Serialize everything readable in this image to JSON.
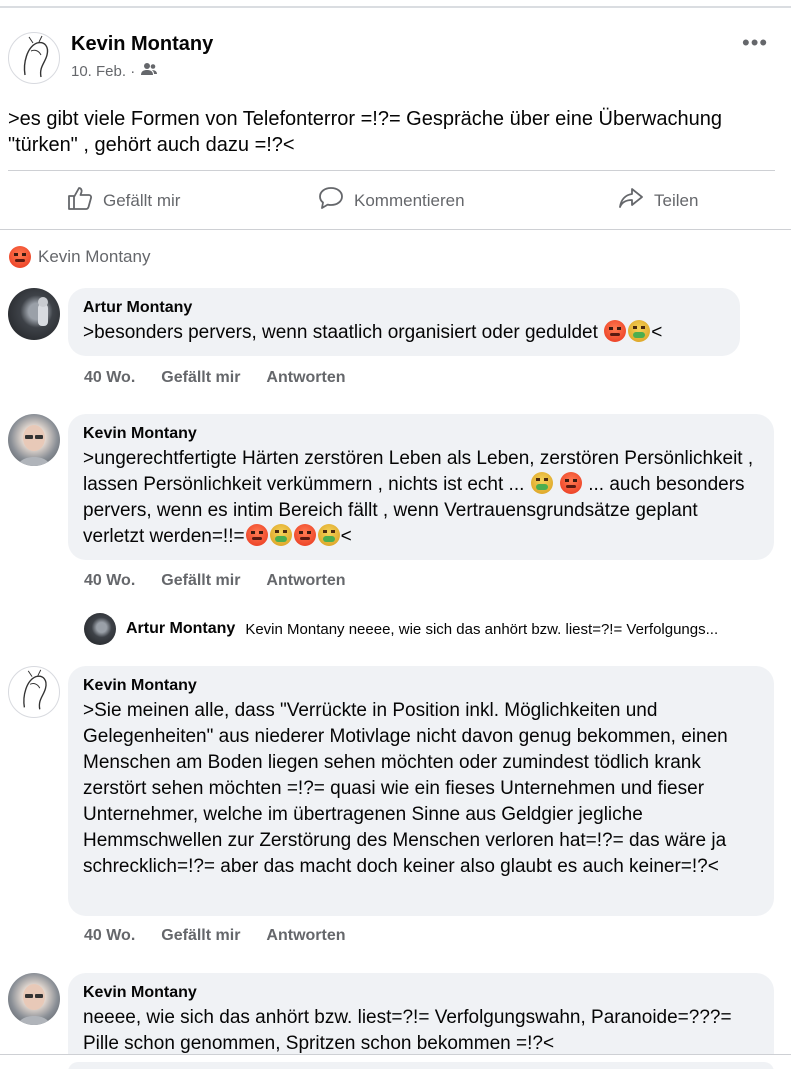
{
  "post": {
    "author": "Kevin Montany",
    "date": "10. Feb. ·",
    "text": ">es gibt viele Formen von Telefonterror =!?= Gespräche über eine Überwachung \"türken\" , gehört auch dazu =!?<"
  },
  "actions": {
    "like": "Gefällt mir",
    "comment": "Kommentieren",
    "share": "Teilen"
  },
  "reaction": {
    "icon": "angry-emoji",
    "name": "Kevin Montany"
  },
  "comments": [
    {
      "author": "Artur Montany",
      "text": ">besonders pervers, wenn staatlich organisiert oder geduldet",
      "suffix": "<",
      "time": "40 Wo.",
      "like": "Gefällt mir",
      "reply": "Antworten"
    },
    {
      "author": "Kevin Montany",
      "text1": ">ungerechtfertigte Härten zerstören Leben als Leben, zerstören Persönlichkeit , lassen Persönlichkeit verkümmern , nichts ist echt ...",
      "text2": "... auch  besonders pervers, wenn es intim Bereich fällt , wenn Vertrauensgrundsätze geplant verletzt werden=!!=",
      "suffix": "<",
      "time": "40 Wo.",
      "like": "Gefällt mir",
      "reply": "Antworten"
    },
    {
      "author": "Kevin Montany",
      "text": ">Sie meinen alle, dass \"Verrückte in Position inkl. Möglichkeiten und Gelegenheiten\"  aus niederer Motivlage nicht davon genug bekommen, einen Menschen am Boden  liegen sehen möchten oder zumindest tödlich krank zerstört sehen möchten =!?= quasi wie ein fieses Unternehmen und fieser Unternehmer, welche im übertragenen Sinne aus Geldgier jegliche Hemmschwellen zur Zerstörung des Menschen verloren hat=!?= das wäre ja schrecklich=!?= aber das macht doch keiner also glaubt es auch keiner=!?<",
      "time": "40 Wo.",
      "like": "Gefällt mir",
      "reply": "Antworten"
    },
    {
      "author": "Kevin Montany",
      "text": "neeee, wie sich das anhört bzw. liest=?!= Verfolgungswahn, Paranoide=???= Pille schon genommen, Spritzen schon bekommen =!?<"
    }
  ],
  "reply_preview": {
    "author": "Artur Montany",
    "text": "Kevin Montany neeee, wie sich das anhört bzw. liest=?!= Verfolgungs..."
  }
}
